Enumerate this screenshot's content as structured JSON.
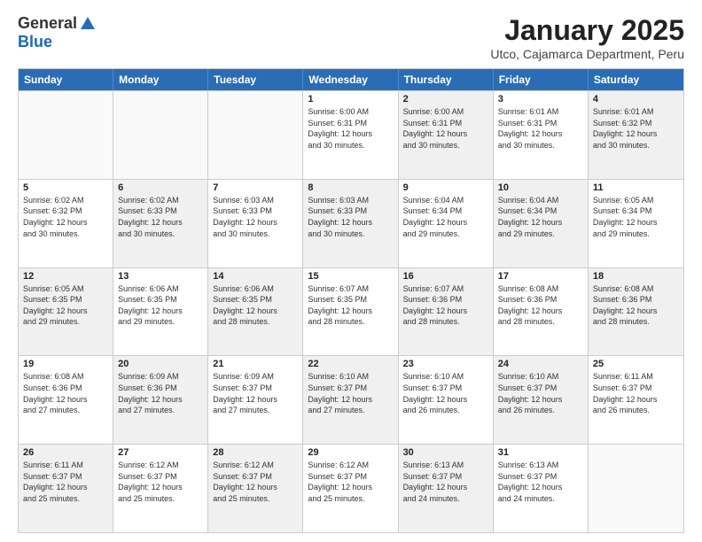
{
  "logo": {
    "general": "General",
    "blue": "Blue"
  },
  "title": "January 2025",
  "subtitle": "Utco, Cajamarca Department, Peru",
  "header_days": [
    "Sunday",
    "Monday",
    "Tuesday",
    "Wednesday",
    "Thursday",
    "Friday",
    "Saturday"
  ],
  "weeks": [
    [
      {
        "day": "",
        "info": "",
        "shaded": false,
        "empty": true
      },
      {
        "day": "",
        "info": "",
        "shaded": false,
        "empty": true
      },
      {
        "day": "",
        "info": "",
        "shaded": false,
        "empty": true
      },
      {
        "day": "1",
        "info": "Sunrise: 6:00 AM\nSunset: 6:31 PM\nDaylight: 12 hours\nand 30 minutes.",
        "shaded": false,
        "empty": false
      },
      {
        "day": "2",
        "info": "Sunrise: 6:00 AM\nSunset: 6:31 PM\nDaylight: 12 hours\nand 30 minutes.",
        "shaded": true,
        "empty": false
      },
      {
        "day": "3",
        "info": "Sunrise: 6:01 AM\nSunset: 6:31 PM\nDaylight: 12 hours\nand 30 minutes.",
        "shaded": false,
        "empty": false
      },
      {
        "day": "4",
        "info": "Sunrise: 6:01 AM\nSunset: 6:32 PM\nDaylight: 12 hours\nand 30 minutes.",
        "shaded": true,
        "empty": false
      }
    ],
    [
      {
        "day": "5",
        "info": "Sunrise: 6:02 AM\nSunset: 6:32 PM\nDaylight: 12 hours\nand 30 minutes.",
        "shaded": false,
        "empty": false
      },
      {
        "day": "6",
        "info": "Sunrise: 6:02 AM\nSunset: 6:33 PM\nDaylight: 12 hours\nand 30 minutes.",
        "shaded": true,
        "empty": false
      },
      {
        "day": "7",
        "info": "Sunrise: 6:03 AM\nSunset: 6:33 PM\nDaylight: 12 hours\nand 30 minutes.",
        "shaded": false,
        "empty": false
      },
      {
        "day": "8",
        "info": "Sunrise: 6:03 AM\nSunset: 6:33 PM\nDaylight: 12 hours\nand 30 minutes.",
        "shaded": true,
        "empty": false
      },
      {
        "day": "9",
        "info": "Sunrise: 6:04 AM\nSunset: 6:34 PM\nDaylight: 12 hours\nand 29 minutes.",
        "shaded": false,
        "empty": false
      },
      {
        "day": "10",
        "info": "Sunrise: 6:04 AM\nSunset: 6:34 PM\nDaylight: 12 hours\nand 29 minutes.",
        "shaded": true,
        "empty": false
      },
      {
        "day": "11",
        "info": "Sunrise: 6:05 AM\nSunset: 6:34 PM\nDaylight: 12 hours\nand 29 minutes.",
        "shaded": false,
        "empty": false
      }
    ],
    [
      {
        "day": "12",
        "info": "Sunrise: 6:05 AM\nSunset: 6:35 PM\nDaylight: 12 hours\nand 29 minutes.",
        "shaded": true,
        "empty": false
      },
      {
        "day": "13",
        "info": "Sunrise: 6:06 AM\nSunset: 6:35 PM\nDaylight: 12 hours\nand 29 minutes.",
        "shaded": false,
        "empty": false
      },
      {
        "day": "14",
        "info": "Sunrise: 6:06 AM\nSunset: 6:35 PM\nDaylight: 12 hours\nand 28 minutes.",
        "shaded": true,
        "empty": false
      },
      {
        "day": "15",
        "info": "Sunrise: 6:07 AM\nSunset: 6:35 PM\nDaylight: 12 hours\nand 28 minutes.",
        "shaded": false,
        "empty": false
      },
      {
        "day": "16",
        "info": "Sunrise: 6:07 AM\nSunset: 6:36 PM\nDaylight: 12 hours\nand 28 minutes.",
        "shaded": true,
        "empty": false
      },
      {
        "day": "17",
        "info": "Sunrise: 6:08 AM\nSunset: 6:36 PM\nDaylight: 12 hours\nand 28 minutes.",
        "shaded": false,
        "empty": false
      },
      {
        "day": "18",
        "info": "Sunrise: 6:08 AM\nSunset: 6:36 PM\nDaylight: 12 hours\nand 28 minutes.",
        "shaded": true,
        "empty": false
      }
    ],
    [
      {
        "day": "19",
        "info": "Sunrise: 6:08 AM\nSunset: 6:36 PM\nDaylight: 12 hours\nand 27 minutes.",
        "shaded": false,
        "empty": false
      },
      {
        "day": "20",
        "info": "Sunrise: 6:09 AM\nSunset: 6:36 PM\nDaylight: 12 hours\nand 27 minutes.",
        "shaded": true,
        "empty": false
      },
      {
        "day": "21",
        "info": "Sunrise: 6:09 AM\nSunset: 6:37 PM\nDaylight: 12 hours\nand 27 minutes.",
        "shaded": false,
        "empty": false
      },
      {
        "day": "22",
        "info": "Sunrise: 6:10 AM\nSunset: 6:37 PM\nDaylight: 12 hours\nand 27 minutes.",
        "shaded": true,
        "empty": false
      },
      {
        "day": "23",
        "info": "Sunrise: 6:10 AM\nSunset: 6:37 PM\nDaylight: 12 hours\nand 26 minutes.",
        "shaded": false,
        "empty": false
      },
      {
        "day": "24",
        "info": "Sunrise: 6:10 AM\nSunset: 6:37 PM\nDaylight: 12 hours\nand 26 minutes.",
        "shaded": true,
        "empty": false
      },
      {
        "day": "25",
        "info": "Sunrise: 6:11 AM\nSunset: 6:37 PM\nDaylight: 12 hours\nand 26 minutes.",
        "shaded": false,
        "empty": false
      }
    ],
    [
      {
        "day": "26",
        "info": "Sunrise: 6:11 AM\nSunset: 6:37 PM\nDaylight: 12 hours\nand 25 minutes.",
        "shaded": true,
        "empty": false
      },
      {
        "day": "27",
        "info": "Sunrise: 6:12 AM\nSunset: 6:37 PM\nDaylight: 12 hours\nand 25 minutes.",
        "shaded": false,
        "empty": false
      },
      {
        "day": "28",
        "info": "Sunrise: 6:12 AM\nSunset: 6:37 PM\nDaylight: 12 hours\nand 25 minutes.",
        "shaded": true,
        "empty": false
      },
      {
        "day": "29",
        "info": "Sunrise: 6:12 AM\nSunset: 6:37 PM\nDaylight: 12 hours\nand 25 minutes.",
        "shaded": false,
        "empty": false
      },
      {
        "day": "30",
        "info": "Sunrise: 6:13 AM\nSunset: 6:37 PM\nDaylight: 12 hours\nand 24 minutes.",
        "shaded": true,
        "empty": false
      },
      {
        "day": "31",
        "info": "Sunrise: 6:13 AM\nSunset: 6:37 PM\nDaylight: 12 hours\nand 24 minutes.",
        "shaded": false,
        "empty": false
      },
      {
        "day": "",
        "info": "",
        "shaded": false,
        "empty": true
      }
    ]
  ]
}
